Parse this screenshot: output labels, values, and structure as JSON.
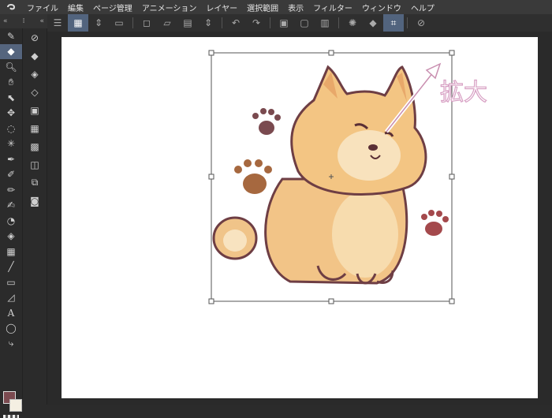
{
  "menu": {
    "items": [
      "ファイル",
      "編集",
      "ページ管理",
      "アニメーション",
      "レイヤー",
      "選択範囲",
      "表示",
      "フィルター",
      "ウィンドウ",
      "ヘルプ"
    ]
  },
  "annotation": {
    "text": "拡大"
  },
  "colors": {
    "main": "#7b4a50",
    "sub": "#f4efe2",
    "accent": "#55657e"
  }
}
